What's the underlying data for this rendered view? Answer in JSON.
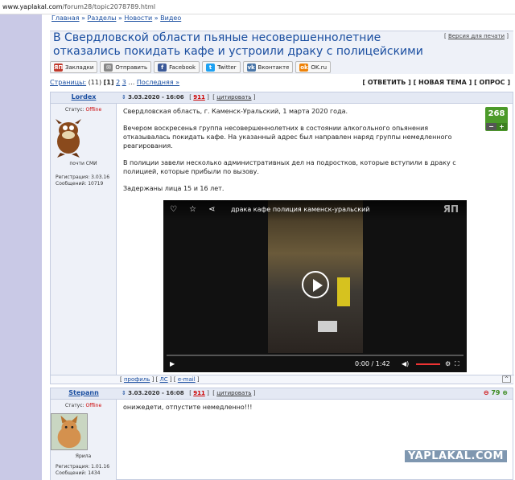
{
  "browser": {
    "url_host": "www.yaplakal.com",
    "url_path": "/forum28/topic2078789.html"
  },
  "breadcrumbs": [
    "Главная",
    "Разделы",
    "Новости",
    "Видео"
  ],
  "topic": {
    "title": "В Свердловской области пьяные несовершеннолетние отказались покидать кафе и устроили драку с полицейскими",
    "print_version": "Версия для печати"
  },
  "share": [
    {
      "label": "Закладки",
      "icon": "yap-icon",
      "color": "#c0392b",
      "glyph": "ЯП"
    },
    {
      "label": "Отправить",
      "icon": "mail-icon",
      "color": "#888888",
      "glyph": "✉"
    },
    {
      "label": "Facebook",
      "icon": "facebook-icon",
      "color": "#3b5998",
      "glyph": "f"
    },
    {
      "label": "Twitter",
      "icon": "twitter-icon",
      "color": "#1da1f2",
      "glyph": "t"
    },
    {
      "label": "Вконтакте",
      "icon": "vk-icon",
      "color": "#4a76a8",
      "glyph": "vk"
    },
    {
      "label": "OK.ru",
      "icon": "ok-icon",
      "color": "#ee8208",
      "glyph": "ok"
    }
  ],
  "pager": {
    "label": "Страницы:",
    "count": "(11)",
    "current": "[1]",
    "p2": "2",
    "p3": "3",
    "last": "Последняя »"
  },
  "actions": "[ ОТВЕТИТЬ ] [ НОВАЯ ТЕМА ] [ ОПРОС ]",
  "post1": {
    "author": "Lordex",
    "status_label": "Статус:",
    "status": "Offline",
    "rank": "почти СМИ",
    "reg": "Регистрация: 3.03.16",
    "msgs": "Сообщений: 10719",
    "date": "3.03.2020 - 16:06",
    "num": "911",
    "cite": "цитировать",
    "rating": "268",
    "paragraphs": [
      "Свердловская область, г. Каменск-Уральский, 1 марта 2020 года.",
      "Вечером воскресенья группа несовершеннолетних в состоянии алкогольного опьянения отказывалась покидать кафе. На указанный адрес был направлен наряд группы немедленного реагирования.",
      "В полиции завели несколько административных дел на подростков, которые вступили в драку с полицией, которые прибыли по вызову.",
      "Задержаны лица 15 и 16 лет."
    ],
    "video": {
      "title": "драка кафе полиция каменск-уральский",
      "time": "0:00 / 1:42",
      "logo": "ЯП",
      "progress": 0
    },
    "footer": {
      "profile": "профиль",
      "pm": "ЛС",
      "email": "e-mail",
      "up": "^"
    }
  },
  "post2": {
    "author": "Stepann",
    "status_label": "Статус:",
    "status": "Offline",
    "rank": "Ярила",
    "reg": "Регистрация: 1.01.16",
    "msgs": "Сообщений: 1434",
    "date": "3.03.2020 - 16:08",
    "num": "911",
    "cite": "цитировать",
    "rating": "79",
    "text": "онижедети, отпустите немедленно!!!"
  },
  "watermark": "YAPLAKAL.COM"
}
